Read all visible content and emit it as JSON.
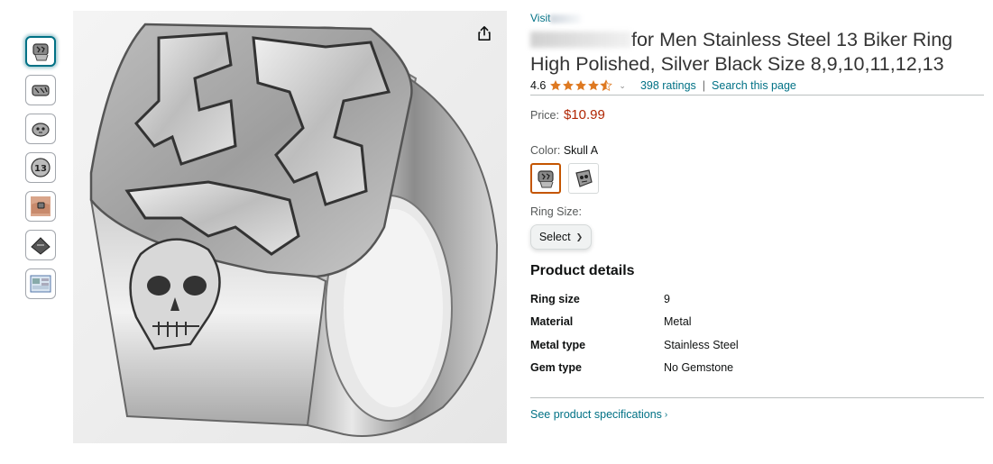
{
  "thumbnails": [
    {
      "name": "thumb-skull-a-ring",
      "active": true
    },
    {
      "name": "thumb-ring-side"
    },
    {
      "name": "thumb-ring-skull"
    },
    {
      "name": "thumb-ring-13"
    },
    {
      "name": "thumb-ring-on-hand"
    },
    {
      "name": "thumb-ring-box"
    },
    {
      "name": "thumb-size-chart"
    }
  ],
  "product": {
    "visit_text": "Visit",
    "title_visible": "for Men Stainless Steel 13 Biker Ring High Polished, Silver Black Size 8,9,10,11,12,13",
    "rating": "4.6",
    "stars_rating": 4.6,
    "ratings_link": "398 ratings",
    "search_link": "Search this page",
    "separator": "|",
    "price_label": "Price:",
    "price_value": "$10.99",
    "color_label": "Color:",
    "color_value": "Skull A",
    "ring_size_label": "Ring Size:",
    "select_label": "Select"
  },
  "details": {
    "heading": "Product details",
    "rows": [
      {
        "key": "Ring size",
        "value": "9"
      },
      {
        "key": "Material",
        "value": "Metal"
      },
      {
        "key": "Metal type",
        "value": "Stainless Steel"
      },
      {
        "key": "Gem type",
        "value": "No Gemstone"
      }
    ],
    "spec_link": "See product specifications"
  },
  "colors": {
    "link": "#007185",
    "price": "#b12704",
    "star": "#de7921",
    "swatch_selected": "#c45500"
  }
}
